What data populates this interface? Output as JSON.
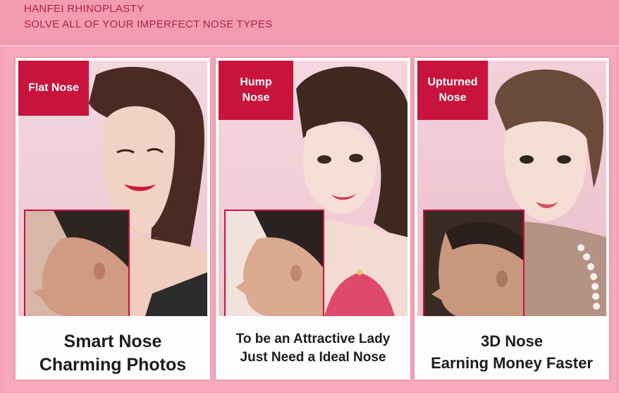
{
  "header": {
    "line1": "HANFEI RHINOPLASTY",
    "line2": "SOLVE ALL OF YOUR IMPERFECT NOSE TYPES"
  },
  "colors": {
    "background": "#f4a3b8",
    "header_text": "#b3223e",
    "tag_bg": "#c8133c",
    "tag_text": "#ffffff",
    "caption_text": "#1d1d1d"
  },
  "cards": [
    {
      "tag_lines": [
        "Flat Nose"
      ],
      "caption_lines": [
        "Smart Nose",
        "Charming Photos"
      ]
    },
    {
      "tag_lines": [
        "Hump",
        "Nose"
      ],
      "caption_lines": [
        "To be an Attractive Lady",
        "Just Need a Ideal Nose"
      ]
    },
    {
      "tag_lines": [
        "Upturned",
        "Nose"
      ],
      "caption_lines": [
        "3D Nose",
        "Earning Money Faster"
      ]
    }
  ]
}
